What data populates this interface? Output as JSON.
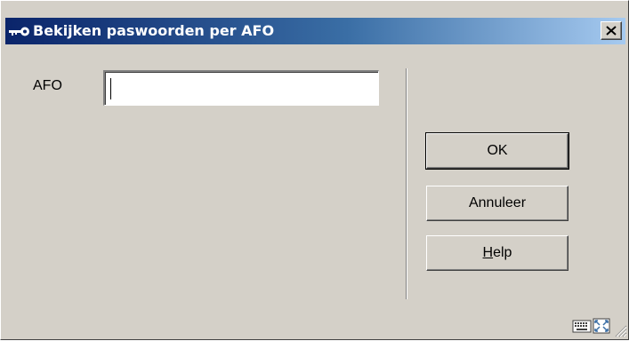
{
  "window": {
    "title": "Bekijken paswoorden per AFO"
  },
  "form": {
    "afo_label": "AFO",
    "afo_value": ""
  },
  "buttons": {
    "ok": "OK",
    "cancel": "Annuleer",
    "help_mnemonic": "H",
    "help_rest": "elp"
  },
  "icons": {
    "title": "key-icon",
    "close": "close-icon",
    "status1": "keyboard-icon",
    "status2": "expand-icon",
    "grip": "resize-grip-icon"
  },
  "colors": {
    "titlebar_start": "#0a246a",
    "titlebar_end": "#a6caf0",
    "dialog_bg": "#d4d0c8"
  }
}
